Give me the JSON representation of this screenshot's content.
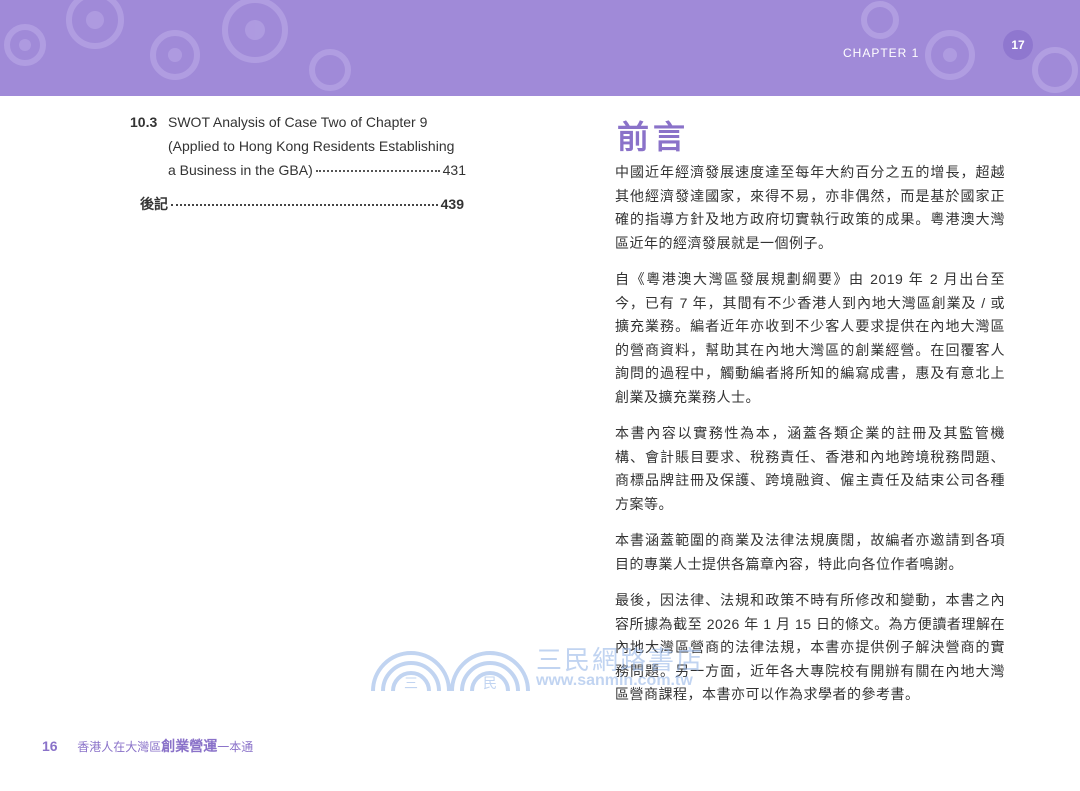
{
  "header": {
    "chapter_label": "CHAPTER 1",
    "page_number_right": "17",
    "band_color": "#a08ad8"
  },
  "toc": {
    "entry_10_3": {
      "number": "10.3",
      "line1": "SWOT Analysis of Case Two of Chapter 9",
      "line2": "(Applied to Hong Kong Residents Establishing",
      "line3": "a Business in the GBA)",
      "page": "431"
    },
    "afterword": {
      "label": "後記",
      "page": "439"
    }
  },
  "preface": {
    "title": "前言",
    "paragraphs": [
      "中國近年經濟發展速度達至每年大約百分之五的增長，超越其他經濟發達國家，來得不易，亦非偶然，而是基於國家正確的指導方針及地方政府切實執行政策的成果。粵港澳大灣區近年的經濟發展就是一個例子。",
      "自《粵港澳大灣區發展規劃綱要》由 2019 年 2 月出台至今，已有 7 年，其間有不少香港人到內地大灣區創業及 / 或擴充業務。編者近年亦收到不少客人要求提供在內地大灣區的營商資料，幫助其在內地大灣區的創業經營。在回覆客人詢問的過程中，觸動編者將所知的編寫成書，惠及有意北上創業及擴充業務人士。",
      "本書內容以實務性為本，涵蓋各類企業的註冊及其監管機構、會計賬目要求、稅務責任、香港和內地跨境稅務問題、商標品牌註冊及保護、跨境融資、僱主責任及結束公司各種方案等。",
      "本書涵蓋範圍的商業及法律法規廣闊，故編者亦邀請到各項目的專業人士提供各篇章內容，特此向各位作者鳴謝。",
      "最後，因法律、法規和政策不時有所修改和變動，本書之內容所據為截至 2026 年 1 月 15 日的條文。為方便讀者理解在內地大灣區營商的法律法規，本書亦提供例子解決營商的實務問題。另一方面，近年各大專院校有開辦有關在內地大灣區營商課程，本書亦可以作為求學者的參考書。"
    ]
  },
  "watermark": {
    "char1": "三",
    "char2": "民",
    "name": "三民網路書店",
    "url": "www.sanmin.com.tw"
  },
  "footer": {
    "page_number_left": "16",
    "book_title_prefix": "香港人在大灣區",
    "book_title_main": "創業營運",
    "book_title_suffix": "一本通"
  }
}
